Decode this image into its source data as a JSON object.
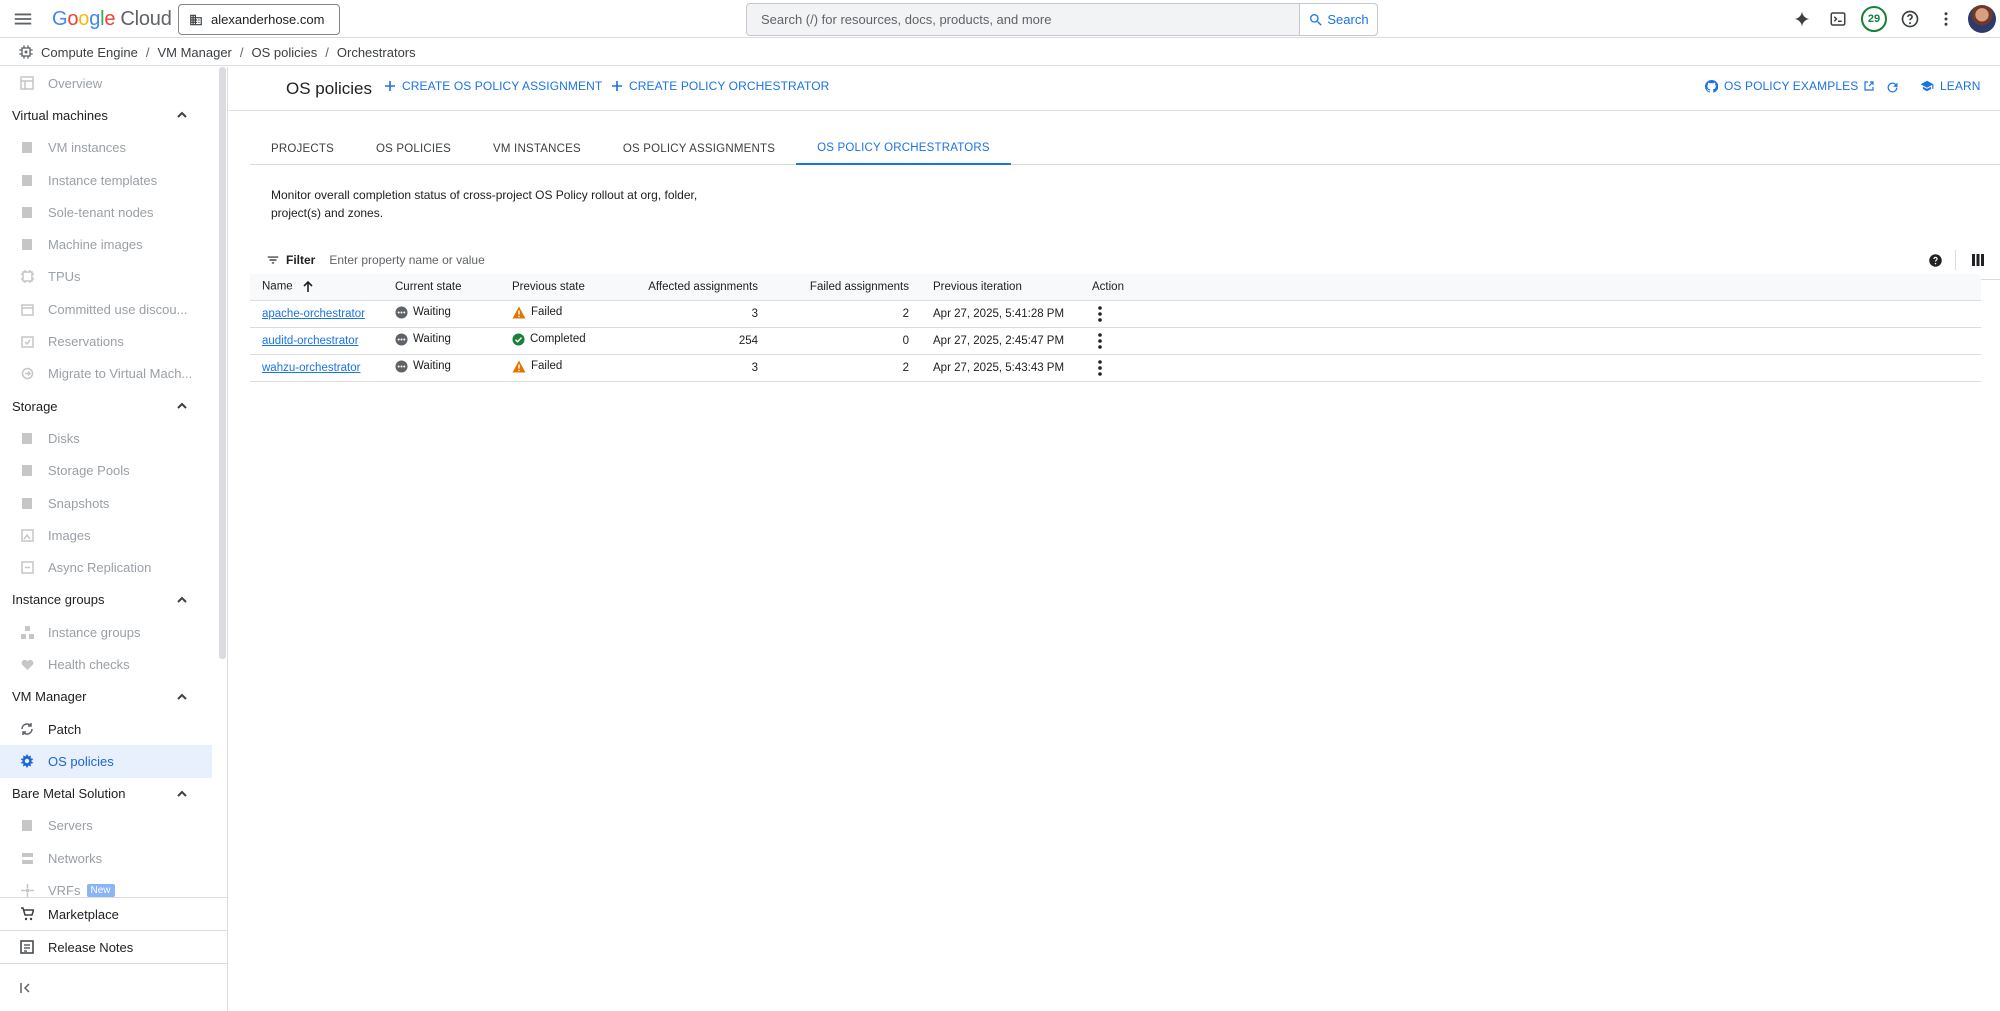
{
  "topbar": {
    "logo_google": "Google",
    "logo_cloud": "Cloud",
    "project": "alexanderhose.com",
    "search_placeholder": "Search (/) for resources, docs, products, and more",
    "search_button": "Search",
    "notification_count": "29"
  },
  "breadcrumb": [
    "Compute Engine",
    "VM Manager",
    "OS policies",
    "Orchestrators"
  ],
  "sidebar": {
    "overview": "Overview",
    "sections": [
      {
        "title": "Virtual machines",
        "items": [
          "VM instances",
          "Instance templates",
          "Sole-tenant nodes",
          "Machine images",
          "TPUs",
          "Committed use discou...",
          "Reservations",
          "Migrate to Virtual Mach..."
        ]
      },
      {
        "title": "Storage",
        "items": [
          "Disks",
          "Storage Pools",
          "Snapshots",
          "Images",
          "Async Replication"
        ]
      },
      {
        "title": "Instance groups",
        "items": [
          "Instance groups",
          "Health checks"
        ]
      },
      {
        "title": "VM Manager",
        "items": [
          "Patch",
          "OS policies"
        ]
      },
      {
        "title": "Bare Metal Solution",
        "items": [
          "Servers",
          "Networks",
          "VRFs"
        ]
      }
    ],
    "new_badge": "New",
    "footer": [
      "Marketplace",
      "Release Notes"
    ]
  },
  "page": {
    "title": "OS policies",
    "create_assignment": "CREATE OS POLICY ASSIGNMENT",
    "create_orchestrator": "CREATE POLICY ORCHESTRATOR",
    "examples": "OS POLICY EXAMPLES",
    "learn": "LEARN"
  },
  "tabs": [
    "PROJECTS",
    "OS POLICIES",
    "VM INSTANCES",
    "OS POLICY ASSIGNMENTS",
    "OS POLICY ORCHESTRATORS"
  ],
  "active_tab": "OS POLICY ORCHESTRATORS",
  "description": "Monitor overall completion status of cross-project OS Policy rollout at org, folder, project(s) and zones.",
  "filter": {
    "label": "Filter",
    "placeholder": "Enter property name or value"
  },
  "table": {
    "columns": [
      "Name",
      "Current state",
      "Previous state",
      "Affected assignments",
      "Failed assignments",
      "Previous iteration",
      "Action"
    ],
    "rows": [
      {
        "name": "apache-orchestrator",
        "current_state": "Waiting",
        "previous_state": "Failed",
        "affected": "3",
        "failed": "2",
        "previous_iteration": "Apr 27, 2025, 5:41:28 PM"
      },
      {
        "name": "auditd-orchestrator",
        "current_state": "Waiting",
        "previous_state": "Completed",
        "affected": "254",
        "failed": "0",
        "previous_iteration": "Apr 27, 2025, 2:45:47 PM"
      },
      {
        "name": "wahzu-orchestrator",
        "current_state": "Waiting",
        "previous_state": "Failed",
        "affected": "3",
        "failed": "2",
        "previous_iteration": "Apr 27, 2025, 5:43:43 PM"
      }
    ]
  },
  "colors": {
    "accent": "#1a73e8",
    "warning": "#e37400",
    "success": "#188038",
    "waiting": "#5f6368"
  }
}
